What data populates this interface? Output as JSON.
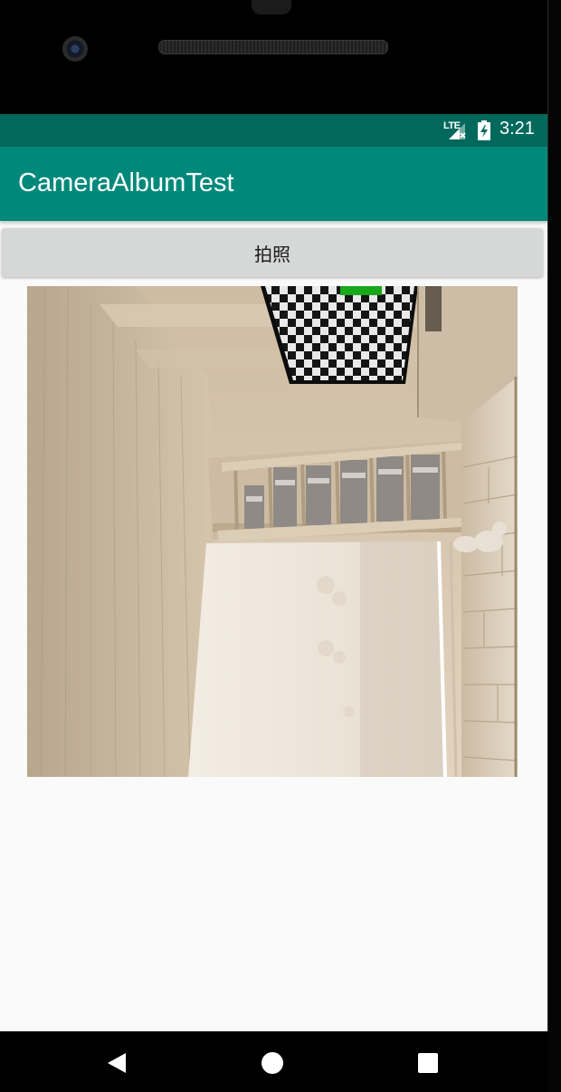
{
  "status_bar": {
    "network": "LTE",
    "time": "3:21",
    "signal_icon": "signal-no-data-icon",
    "battery_icon": "battery-charging-icon"
  },
  "toolbar": {
    "title": "CameraAlbumTest"
  },
  "main": {
    "take_photo_label": "拍照",
    "photo_description_icon": "captured-room-photo"
  },
  "nav_bar": {
    "back": "back-icon",
    "home": "home-icon",
    "recents": "recents-icon"
  },
  "colors": {
    "status_bar": "#00695c",
    "toolbar": "#00897b",
    "button": "#d6d7d7",
    "background": "#fafafa"
  }
}
